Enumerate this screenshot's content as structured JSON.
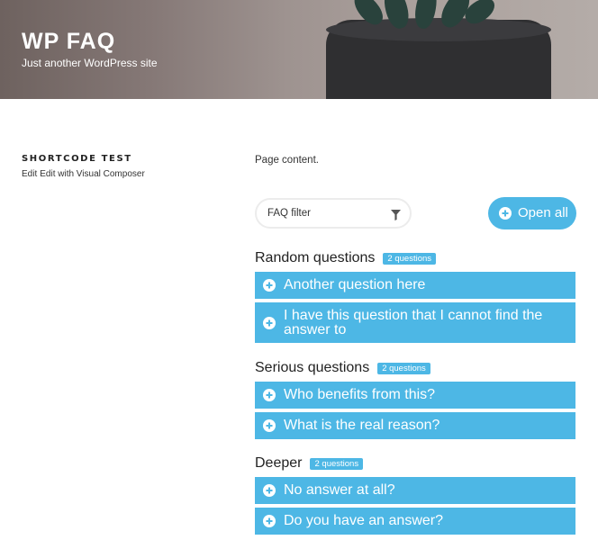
{
  "site": {
    "title": "WP FAQ",
    "tagline": "Just another WordPress site"
  },
  "page": {
    "title": "SHORTCODE TEST",
    "edit_links": [
      "Edit",
      "Edit with Visual Composer"
    ],
    "content": "Page content."
  },
  "faq": {
    "filter_placeholder": "FAQ filter",
    "open_all_label": "Open all",
    "categories": [
      {
        "title": "Random questions",
        "count": "2 questions",
        "questions": [
          "Another question here",
          "I have this question that I cannot find the answer to"
        ]
      },
      {
        "title": "Serious questions",
        "count": "2 questions",
        "questions": [
          "Who benefits from this?",
          "What is the real reason?"
        ]
      },
      {
        "title": "Deeper",
        "count": "2 questions",
        "questions": [
          "No answer at all?",
          "Do you have an answer?"
        ]
      }
    ]
  },
  "colors": {
    "accent": "#4db7e5",
    "header_bg": "#8a7e7b",
    "text": "#222222"
  },
  "icons": {
    "question_toggle": "plus-circle-icon",
    "filter": "funnel-icon",
    "open_all": "plus-circle-icon"
  }
}
